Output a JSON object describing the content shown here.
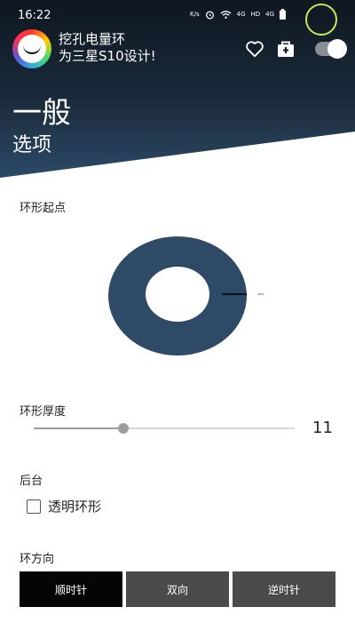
{
  "status_bar": {
    "time": "16:22",
    "speed_label": "K/s",
    "signal_1": "4G",
    "hd_label": "HD",
    "signal_2": "4G"
  },
  "app": {
    "title_line1": "挖孔电量环",
    "title_line2": "为三星S10设计!"
  },
  "page": {
    "title": "一般",
    "subtitle": "选项"
  },
  "ring_start": {
    "label": "环形起点",
    "ring_color": "#2e4a66"
  },
  "ring_thickness": {
    "label": "环形厚度",
    "value": "11",
    "slider_fraction": 0.345
  },
  "background": {
    "label": "后台",
    "transparent_ring_label": "透明环形",
    "transparent_checked": false
  },
  "ring_direction": {
    "label": "环方向",
    "options": [
      "顺时针",
      "双向",
      "逆时针"
    ],
    "selected_index": 0
  },
  "colors": {
    "header_dark": "#0f1720",
    "header_light": "#2c4a66",
    "status_ring": "#c8e85a",
    "button_active": "#050505",
    "button_inactive": "#4a4a4a"
  }
}
